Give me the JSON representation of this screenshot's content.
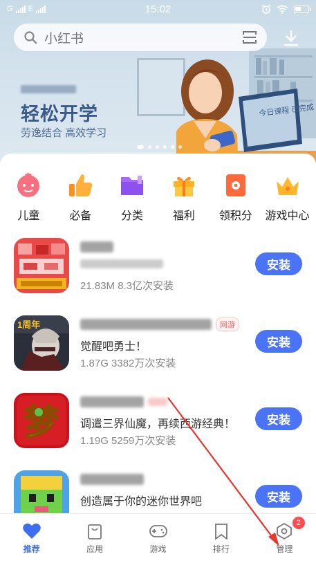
{
  "status_bar": {
    "left_text": "G",
    "left_text2": "E",
    "time": "15:02"
  },
  "search": {
    "placeholder": "小红书"
  },
  "banner": {
    "title": "轻松开学",
    "subtitle": "劳逸结合 高效学习",
    "card_text": "今日课程 已完成"
  },
  "categories": [
    {
      "label": "儿童",
      "icon": "child-face-icon",
      "color": "#f86f7f"
    },
    {
      "label": "必备",
      "icon": "thumbs-up-icon",
      "color": "#ffa733"
    },
    {
      "label": "分类",
      "icon": "folder-icon",
      "color": "#9a5ef5"
    },
    {
      "label": "福利",
      "icon": "gift-icon",
      "color": "#ffb320"
    },
    {
      "label": "领积分",
      "icon": "points-icon",
      "color": "#ff6a3d"
    },
    {
      "label": "游戏中心",
      "icon": "crown-icon",
      "color": "#ffb62d"
    }
  ],
  "apps": [
    {
      "desc": "",
      "meta": "21.83M  8.3亿次安装",
      "tag": "",
      "install": "安装"
    },
    {
      "desc": "觉醒吧勇士！",
      "meta": "1.87G  3382万次安装",
      "tag": "网游",
      "install": "安装",
      "thumb_text": "1周年"
    },
    {
      "desc": "调遣三界仙魔，再续西游经典！",
      "meta": "1.19G  5259万次安装",
      "tag": "",
      "install": "安装",
      "thumb_text": "梦"
    },
    {
      "desc": "创造属于你的迷你世界吧",
      "meta": "",
      "tag": "",
      "install": "安装"
    }
  ],
  "nav": [
    {
      "label": "推荐",
      "icon": "heart-icon"
    },
    {
      "label": "应用",
      "icon": "bag-icon"
    },
    {
      "label": "游戏",
      "icon": "gamepad-icon"
    },
    {
      "label": "排行",
      "icon": "bookmark-icon"
    },
    {
      "label": "管理",
      "icon": "manage-icon",
      "badge": "2"
    }
  ],
  "colors": {
    "accent": "#4a74f5",
    "nav_active": "#3d6ef0",
    "badge": "#ff4d4f",
    "arrow": "#e8352e"
  }
}
